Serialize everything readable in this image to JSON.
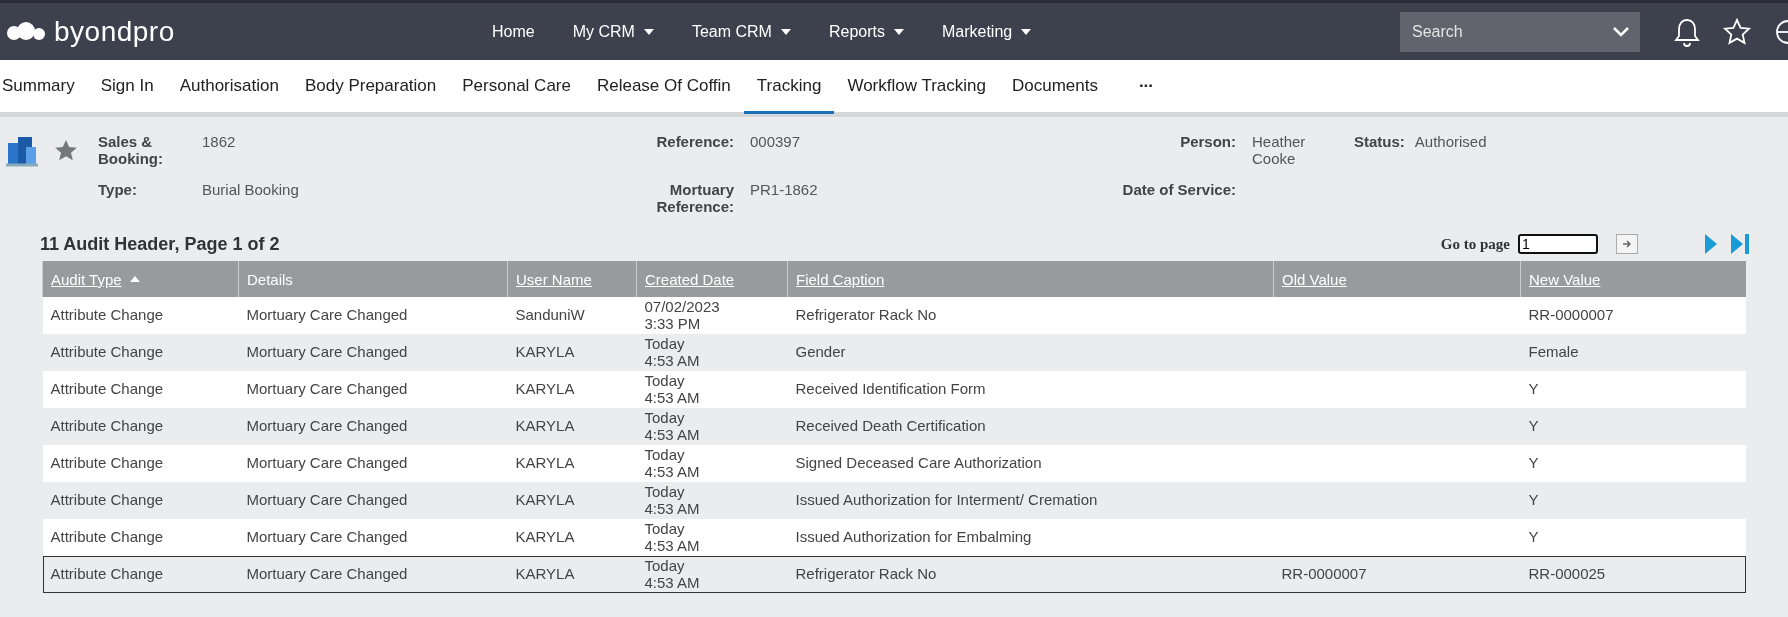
{
  "brand": {
    "name": "byondpro"
  },
  "nav": [
    {
      "label": "Home",
      "dropdown": false
    },
    {
      "label": "My CRM",
      "dropdown": true
    },
    {
      "label": "Team CRM",
      "dropdown": true
    },
    {
      "label": "Reports",
      "dropdown": true
    },
    {
      "label": "Marketing",
      "dropdown": true
    }
  ],
  "search": {
    "placeholder": "Search"
  },
  "tabs": [
    {
      "label": "Summary",
      "selected": false
    },
    {
      "label": "Sign In",
      "selected": false
    },
    {
      "label": "Authorisation",
      "selected": false
    },
    {
      "label": "Body Preparation",
      "selected": false
    },
    {
      "label": "Personal Care",
      "selected": false
    },
    {
      "label": "Release Of Coffin",
      "selected": false
    },
    {
      "label": "Tracking",
      "selected": true
    },
    {
      "label": "Workflow Tracking",
      "selected": false
    },
    {
      "label": "Documents",
      "selected": false
    }
  ],
  "more_tabs": "···",
  "record": {
    "fields": [
      {
        "label": "Sales & Booking:",
        "value": "1862"
      },
      {
        "label": "Reference:",
        "value": "000397"
      },
      {
        "label": "Person:",
        "value": "Heather Cooke"
      },
      {
        "label": "Status:",
        "value": "Authorised"
      },
      {
        "label": "Type:",
        "value": "Burial Booking"
      },
      {
        "label": "Mortuary Reference:",
        "value": "PR1-1862"
      },
      {
        "label": "Date of Service:"
      }
    ]
  },
  "grid": {
    "title": "11 Audit Header, Page 1 of 2",
    "goto_label": "Go to page",
    "goto_value": "1",
    "columns": [
      {
        "label": "Audit Type",
        "link": true,
        "sorted": true
      },
      {
        "label": "Details",
        "link": false,
        "sorted": false
      },
      {
        "label": "User Name",
        "link": true,
        "sorted": false
      },
      {
        "label": "Created Date",
        "link": true,
        "sorted": false
      },
      {
        "label": "Field Caption",
        "link": true,
        "sorted": false
      },
      {
        "label": "Old Value",
        "link": true,
        "sorted": false
      },
      {
        "label": "New Value",
        "link": true,
        "sorted": false
      }
    ],
    "rows": [
      {
        "selected": false,
        "cells": [
          "Attribute Change",
          "Mortuary Care Changed",
          "SanduniW",
          "07/02/2023\n3:33 PM",
          "Refrigerator Rack No",
          "",
          "RR-0000007"
        ]
      },
      {
        "selected": false,
        "cells": [
          "Attribute Change",
          "Mortuary Care Changed",
          "KARYLA",
          "Today\n4:53 AM",
          "Gender",
          "",
          "Female"
        ]
      },
      {
        "selected": false,
        "cells": [
          "Attribute Change",
          "Mortuary Care Changed",
          "KARYLA",
          "Today\n4:53 AM",
          "Received Identification Form",
          "",
          "Y"
        ]
      },
      {
        "selected": false,
        "cells": [
          "Attribute Change",
          "Mortuary Care Changed",
          "KARYLA",
          "Today\n4:53 AM",
          "Received Death Certification",
          "",
          "Y"
        ]
      },
      {
        "selected": false,
        "cells": [
          "Attribute Change",
          "Mortuary Care Changed",
          "KARYLA",
          "Today\n4:53 AM",
          "Signed Deceased Care Authorization",
          "",
          "Y"
        ]
      },
      {
        "selected": false,
        "cells": [
          "Attribute Change",
          "Mortuary Care Changed",
          "KARYLA",
          "Today\n4:53 AM",
          "Issued Authorization for Interment/ Cremation",
          "",
          "Y"
        ]
      },
      {
        "selected": false,
        "cells": [
          "Attribute Change",
          "Mortuary Care Changed",
          "KARYLA",
          "Today\n4:53 AM",
          "Issued Authorization for Embalming",
          "",
          "Y"
        ]
      },
      {
        "selected": true,
        "cells": [
          "Attribute Change",
          "Mortuary Care Changed",
          "KARYLA",
          "Today\n4:53 AM",
          "Refrigerator Rack No",
          "RR-0000007",
          "RR-000025"
        ]
      }
    ]
  }
}
